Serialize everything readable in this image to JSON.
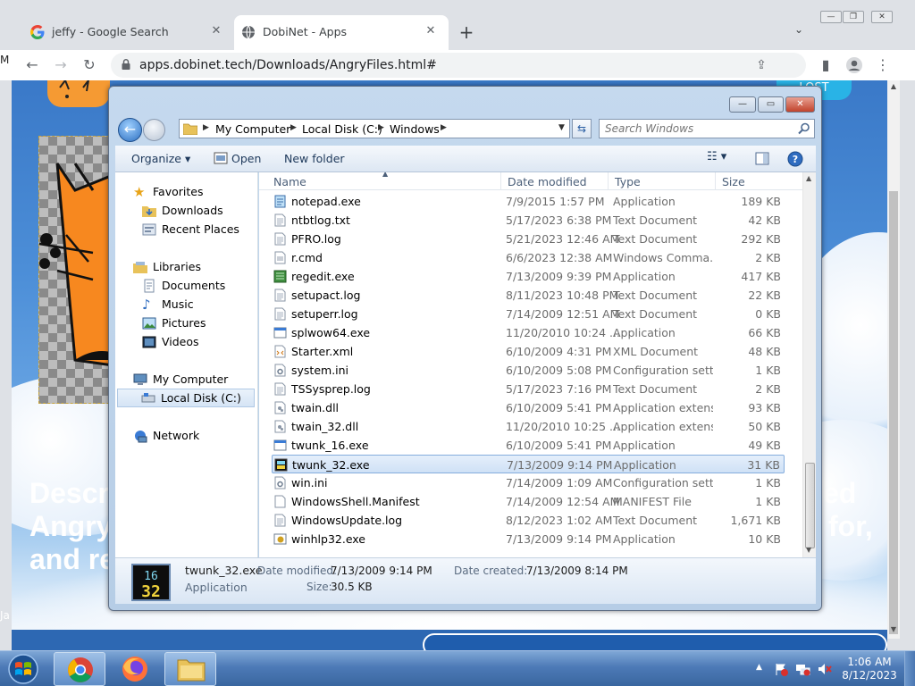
{
  "browser": {
    "tabs": [
      {
        "title": "jeffy - Google Search",
        "favicon": "google-icon"
      },
      {
        "title": "DobiNet - Apps",
        "favicon": "globe-icon"
      }
    ],
    "url": "apps.dobinet.tech/Downloads/AngryFiles.html#"
  },
  "page": {
    "badge": "LOST",
    "hero_left": [
      "Descr",
      "Angry",
      "and re"
    ],
    "hero_right": [
      "ed",
      "for,",
      ""
    ],
    "side_char": "Ja"
  },
  "explorer": {
    "breadcrumb": [
      "My Computer",
      "Local Disk (C:)",
      "Windows"
    ],
    "search_placeholder": "Search Windows",
    "commands": {
      "organize": "Organize",
      "open": "Open",
      "new_folder": "New folder"
    },
    "nav": {
      "favorites": "Favorites",
      "downloads": "Downloads",
      "recent": "Recent Places",
      "libraries": "Libraries",
      "documents": "Documents",
      "music": "Music",
      "pictures": "Pictures",
      "videos": "Videos",
      "computer": "My Computer",
      "local_disk": "Local Disk (C:)",
      "network": "Network"
    },
    "columns": {
      "name": "Name",
      "date": "Date modified",
      "type": "Type",
      "size": "Size"
    },
    "files": [
      {
        "name": "notepad.exe",
        "date": "7/9/2015 1:57 PM",
        "type": "Application",
        "size": "189 KB",
        "icon": "notepad-icon"
      },
      {
        "name": "ntbtlog.txt",
        "date": "5/17/2023 6:38 PM",
        "type": "Text Document",
        "size": "42 KB",
        "icon": "text-file-icon"
      },
      {
        "name": "PFRO.log",
        "date": "5/21/2023 12:46 AM",
        "type": "Text Document",
        "size": "292 KB",
        "icon": "text-file-icon"
      },
      {
        "name": "r.cmd",
        "date": "6/6/2023 12:38 AM",
        "type": "Windows Comma...",
        "size": "2 KB",
        "icon": "cmd-file-icon"
      },
      {
        "name": "regedit.exe",
        "date": "7/13/2009 9:39 PM",
        "type": "Application",
        "size": "417 KB",
        "icon": "regedit-icon"
      },
      {
        "name": "setupact.log",
        "date": "8/11/2023 10:48 PM",
        "type": "Text Document",
        "size": "22 KB",
        "icon": "text-file-icon"
      },
      {
        "name": "setuperr.log",
        "date": "7/14/2009 12:51 AM",
        "type": "Text Document",
        "size": "0 KB",
        "icon": "text-file-icon"
      },
      {
        "name": "splwow64.exe",
        "date": "11/20/2010 10:24 ...",
        "type": "Application",
        "size": "66 KB",
        "icon": "app-window-icon"
      },
      {
        "name": "Starter.xml",
        "date": "6/10/2009 4:31 PM",
        "type": "XML Document",
        "size": "48 KB",
        "icon": "xml-file-icon"
      },
      {
        "name": "system.ini",
        "date": "6/10/2009 5:08 PM",
        "type": "Configuration sett...",
        "size": "1 KB",
        "icon": "config-file-icon"
      },
      {
        "name": "TSSysprep.log",
        "date": "5/17/2023 7:16 PM",
        "type": "Text Document",
        "size": "2 KB",
        "icon": "text-file-icon"
      },
      {
        "name": "twain.dll",
        "date": "6/10/2009 5:41 PM",
        "type": "Application extens...",
        "size": "93 KB",
        "icon": "dll-file-icon"
      },
      {
        "name": "twain_32.dll",
        "date": "11/20/2010 10:25 ...",
        "type": "Application extens...",
        "size": "50 KB",
        "icon": "dll-file-icon"
      },
      {
        "name": "twunk_16.exe",
        "date": "6/10/2009 5:41 PM",
        "type": "Application",
        "size": "49 KB",
        "icon": "app-window-icon"
      },
      {
        "name": "twunk_32.exe",
        "date": "7/13/2009 9:14 PM",
        "type": "Application",
        "size": "31 KB",
        "icon": "twunk-icon",
        "selected": true
      },
      {
        "name": "win.ini",
        "date": "7/14/2009 1:09 AM",
        "type": "Configuration sett...",
        "size": "1 KB",
        "icon": "config-file-icon"
      },
      {
        "name": "WindowsShell.Manifest",
        "date": "7/14/2009 12:54 AM",
        "type": "MANIFEST File",
        "size": "1 KB",
        "icon": "blank-file-icon"
      },
      {
        "name": "WindowsUpdate.log",
        "date": "8/12/2023 1:02 AM",
        "type": "Text Document",
        "size": "1,671 KB",
        "icon": "text-file-icon"
      },
      {
        "name": "winhlp32.exe",
        "date": "7/13/2009 9:14 PM",
        "type": "Application",
        "size": "10 KB",
        "icon": "help-app-icon"
      }
    ],
    "details": {
      "name": "twunk_32.exe",
      "type": "Application",
      "date_modified_label": "Date modified:",
      "date_modified": "7/13/2009 9:14 PM",
      "date_created_label": "Date created:",
      "date_created": "7/13/2009 8:14 PM",
      "size_label": "Size:",
      "size": "30.5 KB",
      "icon_text_top": "16",
      "icon_text_bottom": "32"
    }
  },
  "taskbar": {
    "time": "1:06 AM",
    "date": "8/12/2023"
  }
}
